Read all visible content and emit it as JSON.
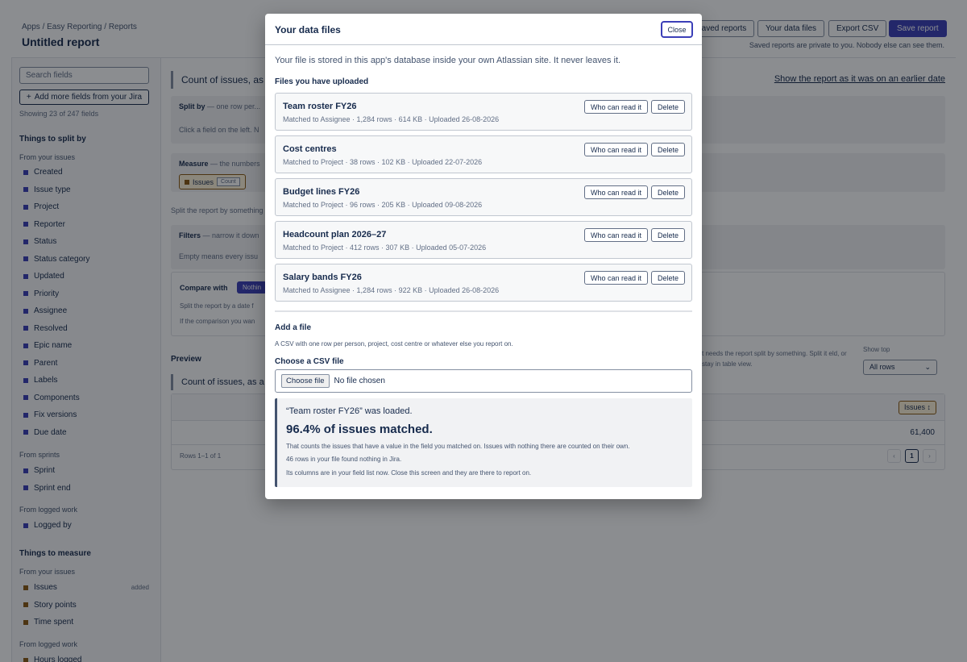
{
  "header": {
    "breadcrumb": "Apps / Easy Reporting / Reports",
    "title": "Untitled report",
    "saved_reports": "Saved reports",
    "data_files": "Your data files",
    "export_csv": "Export CSV",
    "save_report": "Save report",
    "privacy_note": "Saved reports are private to you. Nobody else can see them."
  },
  "sidebar": {
    "search_placeholder": "Search fields",
    "add_more": "Add more fields from your Jira",
    "showing": "Showing 23 of 247 fields",
    "split_heading": "Things to split by",
    "group_issues": "From your issues",
    "split_items": [
      "Created",
      "Issue type",
      "Project",
      "Reporter",
      "Status",
      "Status category",
      "Updated",
      "Priority",
      "Assignee",
      "Resolved",
      "Epic name",
      "Parent",
      "Labels",
      "Components",
      "Fix versions",
      "Due date"
    ],
    "group_sprints": "From sprints",
    "sprint_items": [
      "Sprint",
      "Sprint end"
    ],
    "group_logged": "From logged work",
    "logged_items": [
      "Logged by"
    ],
    "measure_heading": "Things to measure",
    "group_issues_2": "From your issues",
    "measure_items": [
      "Issues",
      "Story points",
      "Time spent"
    ],
    "added_tag": "added",
    "group_logged_2": "From logged work",
    "measure_logged": [
      "Hours logged"
    ]
  },
  "main": {
    "title": "Count of issues, as a",
    "history_link": "Show the report as it was on an earlier date",
    "split_label": "Split by",
    "split_hint": "— one row per...",
    "split_body": "Click a field on the left. N",
    "measure_label": "Measure",
    "measure_hint": "— the numbers",
    "measure_pill": "Issues",
    "measure_count": "Count",
    "split_note": "Split the report by something",
    "filters_label": "Filters",
    "filters_hint": "— narrow it down",
    "filters_body": "Empty means every issu",
    "compare_label": "Compare with",
    "compare_btn": "Nothin",
    "compare_l1": "Split the report by a date f",
    "compare_l2": "If the comparison you wan",
    "preview_label": "Preview",
    "preview_note": "t needs the report split by something. Split it eld, or stay in table view.",
    "show_top_label": "Show top",
    "show_top_value": "All rows",
    "preview_title": "Count of issues, as a s",
    "issues_header": "Issues ↕",
    "value": "61,400",
    "rows_text": "Rows 1–1 of 1",
    "page_prev": "‹",
    "page_current": "1",
    "page_next": "›"
  },
  "modal": {
    "title": "Your data files",
    "close": "Close",
    "intro": "Your file is stored in this app's database inside your own Atlassian site. It never leaves it.",
    "uploaded_heading": "Files you have uploaded",
    "who_can_read": "Who can read it",
    "delete": "Delete",
    "files": [
      {
        "name": "Team roster FY26",
        "meta": "Matched to Assignee · 1,284 rows · 614 KB · Uploaded 26-08-2026"
      },
      {
        "name": "Cost centres",
        "meta": "Matched to Project · 38 rows · 102 KB · Uploaded 22-07-2026"
      },
      {
        "name": "Budget lines FY26",
        "meta": "Matched to Project · 96 rows · 205 KB · Uploaded 09-08-2026"
      },
      {
        "name": "Headcount plan 2026–27",
        "meta": "Matched to Project · 412 rows · 307 KB · Uploaded 05-07-2026"
      },
      {
        "name": "Salary bands FY26",
        "meta": "Matched to Assignee · 1,284 rows · 922 KB · Uploaded 26-08-2026"
      }
    ],
    "add_heading": "Add a file",
    "add_desc": "A CSV with one row per person, project, cost centre or whatever else you report on.",
    "choose_label": "Choose a CSV file",
    "choose_button": "Choose file",
    "no_file": "No file chosen",
    "result_loaded": "“Team roster FY26” was loaded.",
    "result_pct": "96.4% of issues matched.",
    "result_l1": "That counts the issues that have a value in the field you matched on. Issues with nothing there are counted on their own.",
    "result_l2": "46 rows in your file found nothing in Jira.",
    "result_l3": "Its columns are in your field list now. Close this screen and they are there to report on."
  },
  "colors": {
    "accent": "#3b3fb8",
    "measure": "#8a5a14"
  }
}
